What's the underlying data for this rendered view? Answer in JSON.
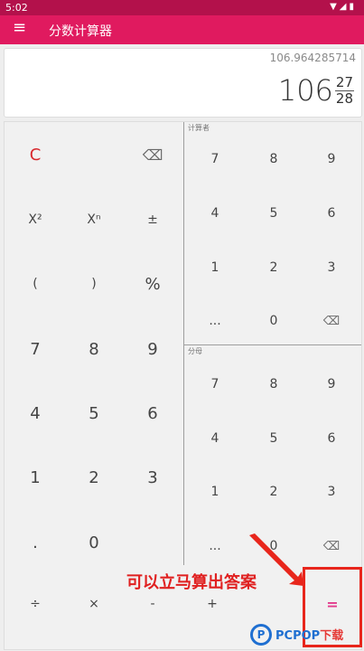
{
  "status_bar": {
    "time": "5:02",
    "icons": [
      "wifi-icon",
      "signal-icon",
      "battery-icon"
    ]
  },
  "app_bar": {
    "menu_icon": "menu-icon",
    "title": "分数计算器"
  },
  "display": {
    "decimal": "106.964285714",
    "whole": "106",
    "numerator": "27",
    "denominator": "28"
  },
  "main_keys": [
    [
      "C",
      "",
      "⌫"
    ],
    [
      "X²",
      "Xⁿ",
      "±"
    ],
    [
      "(",
      ")",
      "%"
    ],
    [
      "7",
      "8",
      "9"
    ],
    [
      "4",
      "5",
      "6"
    ],
    [
      "1",
      "2",
      "3"
    ],
    [
      ".",
      "0",
      ""
    ]
  ],
  "operators": [
    "÷",
    "×",
    "-",
    "+",
    "="
  ],
  "numerator_pad": {
    "label": "计算者",
    "keys": [
      [
        "7",
        "8",
        "9"
      ],
      [
        "4",
        "5",
        "6"
      ],
      [
        "1",
        "2",
        "3"
      ],
      [
        "...",
        "0",
        "⌫"
      ]
    ]
  },
  "denominator_pad": {
    "label": "分母",
    "keys": [
      [
        "7",
        "8",
        "9"
      ],
      [
        "4",
        "5",
        "6"
      ],
      [
        "1",
        "2",
        "3"
      ],
      [
        "...",
        "0",
        "⌫"
      ]
    ]
  },
  "annotation": "可以立马算出答案",
  "watermark": {
    "logo": "P",
    "brand": "PCPOP",
    "suffix": "下载"
  },
  "colors": {
    "primary": "#e01a5f",
    "status": "#b3114b",
    "clear": "#d8282d",
    "equals": "#e23a8c",
    "highlight": "#e8261c"
  }
}
